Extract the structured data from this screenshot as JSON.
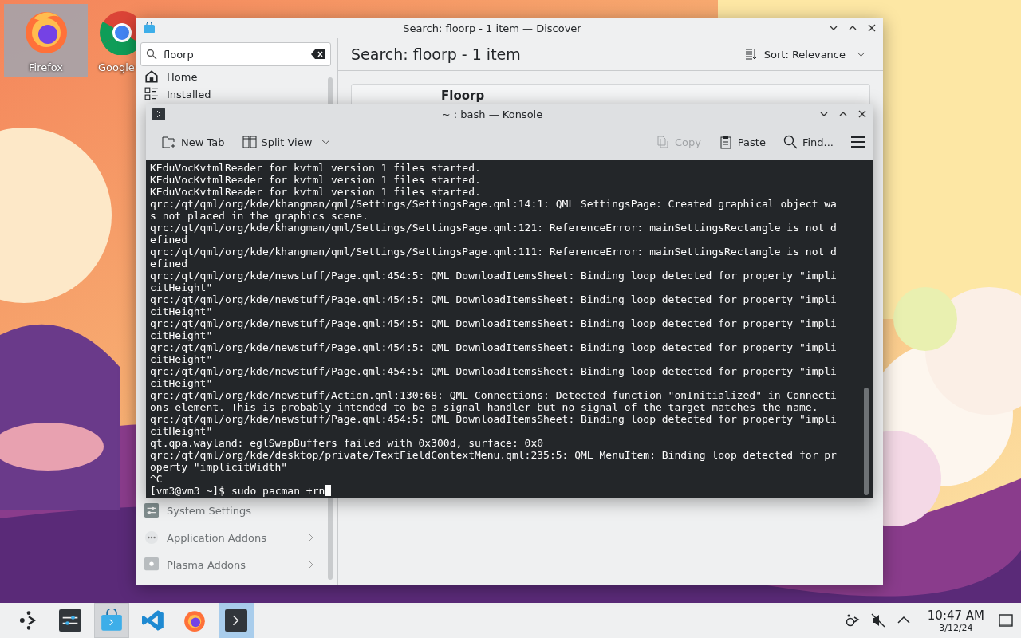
{
  "desktop": {
    "icons": [
      {
        "kind": "firefox",
        "label": "Firefox",
        "selected": true
      },
      {
        "kind": "chrome",
        "label": "Google",
        "selected": false
      }
    ]
  },
  "discover": {
    "title": "Search: floorp - 1 item — Discover",
    "search": {
      "value": "floorp"
    },
    "heading": "Search: floorp - 1 item",
    "sort": "Sort: Relevance",
    "card_title": "Floorp",
    "sidebar": {
      "top_items": [
        {
          "kind": "home",
          "label": "Home",
          "has_children": false
        },
        {
          "kind": "installed",
          "label": "Installed",
          "has_children": false
        }
      ],
      "bottom_items": [
        {
          "kind": "settings",
          "label": "System Settings",
          "has_children": false
        },
        {
          "kind": "addons",
          "label": "Application Addons",
          "has_children": true
        },
        {
          "kind": "plasma",
          "label": "Plasma Addons",
          "has_children": true
        }
      ]
    }
  },
  "konsole": {
    "title": "~ : bash — Konsole",
    "toolbar_left": [
      {
        "kind": "newtab",
        "label": "New Tab",
        "disabled": false
      },
      {
        "kind": "split",
        "label": "Split View",
        "disabled": false
      }
    ],
    "toolbar_right": [
      {
        "kind": "copy",
        "label": "Copy",
        "disabled": true
      },
      {
        "kind": "paste",
        "label": "Paste",
        "disabled": false
      },
      {
        "kind": "find",
        "label": "Find...",
        "disabled": false
      }
    ],
    "lines": [
      "KEduVocKvtmlReader for kvtml version 1 files started.",
      "KEduVocKvtmlReader for kvtml version 1 files started.",
      "KEduVocKvtmlReader for kvtml version 1 files started.",
      "qrc:/qt/qml/org/kde/khangman/qml/Settings/SettingsPage.qml:14:1: QML SettingsPage: Created graphical object wa",
      "s not placed in the graphics scene.",
      "qrc:/qt/qml/org/kde/khangman/qml/Settings/SettingsPage.qml:121: ReferenceError: mainSettingsRectangle is not d",
      "efined",
      "qrc:/qt/qml/org/kde/khangman/qml/Settings/SettingsPage.qml:111: ReferenceError: mainSettingsRectangle is not d",
      "efined",
      "qrc:/qt/qml/org/kde/newstuff/Page.qml:454:5: QML DownloadItemsSheet: Binding loop detected for property \"impli",
      "citHeight\"",
      "qrc:/qt/qml/org/kde/newstuff/Page.qml:454:5: QML DownloadItemsSheet: Binding loop detected for property \"impli",
      "citHeight\"",
      "qrc:/qt/qml/org/kde/newstuff/Page.qml:454:5: QML DownloadItemsSheet: Binding loop detected for property \"impli",
      "citHeight\"",
      "qrc:/qt/qml/org/kde/newstuff/Page.qml:454:5: QML DownloadItemsSheet: Binding loop detected for property \"impli",
      "citHeight\"",
      "qrc:/qt/qml/org/kde/newstuff/Page.qml:454:5: QML DownloadItemsSheet: Binding loop detected for property \"impli",
      "citHeight\"",
      "qrc:/qt/qml/org/kde/newstuff/Action.qml:130:68: QML Connections: Detected function \"onInitialized\" in Connecti",
      "ons element. This is probably intended to be a signal handler but no signal of the target matches the name.",
      "qrc:/qt/qml/org/kde/newstuff/Page.qml:454:5: QML DownloadItemsSheet: Binding loop detected for property \"impli",
      "citHeight\"",
      "qt.qpa.wayland: eglSwapBuffers failed with 0x300d, surface: 0x0",
      "qrc:/qt/qml/org/kde/desktop/private/TextFieldContextMenu.qml:235:5: QML MenuItem: Binding loop detected for pr",
      "operty \"implicitWidth\"",
      "^C"
    ],
    "prompt": "[vm3@vm3 ~]$",
    "command": "sudo pacman +rn"
  },
  "taskbar": {
    "tasks": [
      {
        "kind": "launcher",
        "selected": false,
        "hovered": false
      },
      {
        "kind": "settings",
        "selected": false,
        "hovered": false
      },
      {
        "kind": "discover",
        "selected": false,
        "hovered": true
      },
      {
        "kind": "vscode",
        "selected": false,
        "hovered": false
      },
      {
        "kind": "firefox",
        "selected": false,
        "hovered": false
      },
      {
        "kind": "konsole",
        "selected": true,
        "hovered": false
      }
    ],
    "tray": [
      {
        "kind": "network"
      },
      {
        "kind": "muted"
      },
      {
        "kind": "expand"
      }
    ],
    "time": "10:47 AM",
    "date": "3/12/24"
  }
}
